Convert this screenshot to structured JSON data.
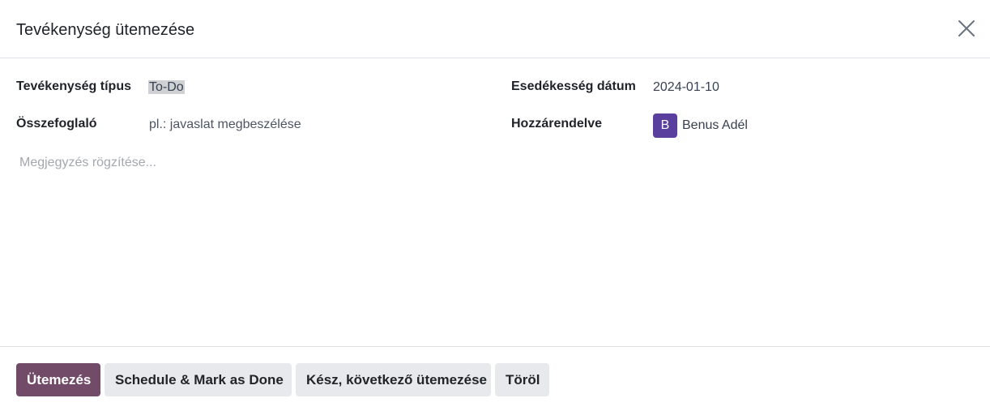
{
  "dialog": {
    "title": "Tevékenység ütemezése"
  },
  "form": {
    "activity_type_label": "Tevékenység típus",
    "activity_type_value": "To-Do",
    "summary_label": "Összefoglaló",
    "summary_placeholder": "pl.: javaslat megbeszélése",
    "due_date_label": "Esedékesség dátum",
    "due_date_value": "2024-01-10",
    "assigned_label": "Hozzárendelve",
    "assigned_avatar_initial": "B",
    "assigned_user": "Benus Adél",
    "note_placeholder": "Megjegyzés rögzítése..."
  },
  "footer": {
    "schedule_label": "Ütemezés",
    "schedule_done_label": "Schedule & Mark as Done",
    "done_next_label": "Kész, következő ütemezése",
    "discard_label": "Töröl"
  },
  "colors": {
    "primary": "#714b67",
    "avatar": "#5b3f9e",
    "secondary_button": "#e7e9ed"
  },
  "icons": {
    "close": "close-icon"
  }
}
